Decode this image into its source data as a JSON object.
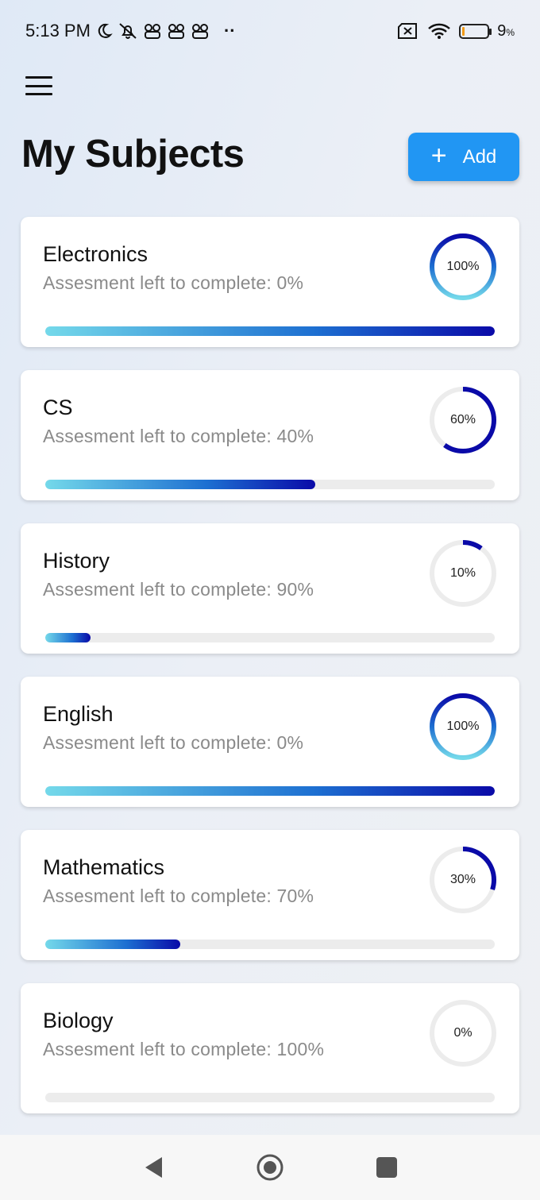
{
  "status_bar": {
    "time": "5:13 PM",
    "dots": "··",
    "battery_percent": "9",
    "battery_unit": "%",
    "icons": [
      "moon-icon",
      "silent-icon",
      "app-notification-icon",
      "app-notification-icon",
      "app-notification-icon",
      "no-sim-icon",
      "wifi-icon",
      "battery-icon"
    ]
  },
  "header": {
    "menu_icon": "hamburger-menu-icon",
    "title": "My Subjects",
    "add_label": "Add",
    "add_icon": "plus-icon",
    "add_color": "#2196f3"
  },
  "subjects": [
    {
      "name": "Electronics",
      "remaining_text": "Assesment left to complete: 0%",
      "progress": 100,
      "progress_label": "100%"
    },
    {
      "name": "CS",
      "remaining_text": "Assesment left to complete: 40%",
      "progress": 60,
      "progress_label": "60%"
    },
    {
      "name": "History",
      "remaining_text": "Assesment left to complete: 90%",
      "progress": 10,
      "progress_label": "10%"
    },
    {
      "name": "English",
      "remaining_text": "Assesment left to complete: 0%",
      "progress": 100,
      "progress_label": "100%"
    },
    {
      "name": "Mathematics",
      "remaining_text": "Assesment left to complete: 70%",
      "progress": 30,
      "progress_label": "30%"
    },
    {
      "name": "Biology",
      "remaining_text": "Assesment left to complete: 100%",
      "progress": 0,
      "progress_label": "0%"
    }
  ],
  "colors": {
    "gradient_start": "#74d9ea",
    "gradient_mid": "#1d6fd1",
    "gradient_end": "#0a0aa8",
    "track": "#ececec"
  },
  "nav_bar": {
    "icons": [
      "back-icon",
      "home-icon",
      "recents-icon"
    ]
  }
}
